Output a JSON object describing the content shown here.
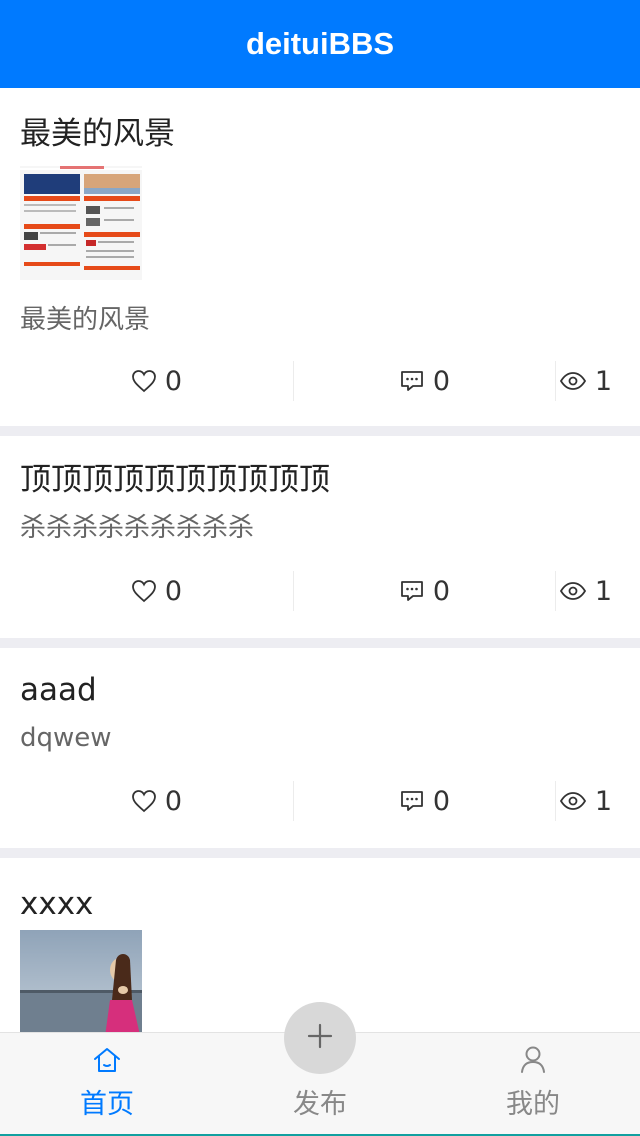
{
  "header": {
    "title": "deituiBBS"
  },
  "posts": [
    {
      "title": "最美的风景",
      "body": "最美的风景",
      "likes": "0",
      "comments": "0",
      "views": "1"
    },
    {
      "title": "顶顶顶顶顶顶顶顶顶顶",
      "body": "杀杀杀杀杀杀杀杀杀",
      "likes": "0",
      "comments": "0",
      "views": "1"
    },
    {
      "title": "aaad",
      "body": "dqwew",
      "likes": "0",
      "comments": "0",
      "views": "1"
    },
    {
      "title": "xxxx"
    }
  ],
  "tabbar": {
    "home_label": "首页",
    "publish_label": "发布",
    "me_label": "我的"
  },
  "colors": {
    "brand": "#007aff",
    "inactive": "#888888",
    "fab": "#d8d8d8"
  },
  "icons": [
    "heart-icon",
    "comment-icon",
    "eye-icon",
    "home-icon",
    "plus-icon",
    "user-icon"
  ]
}
